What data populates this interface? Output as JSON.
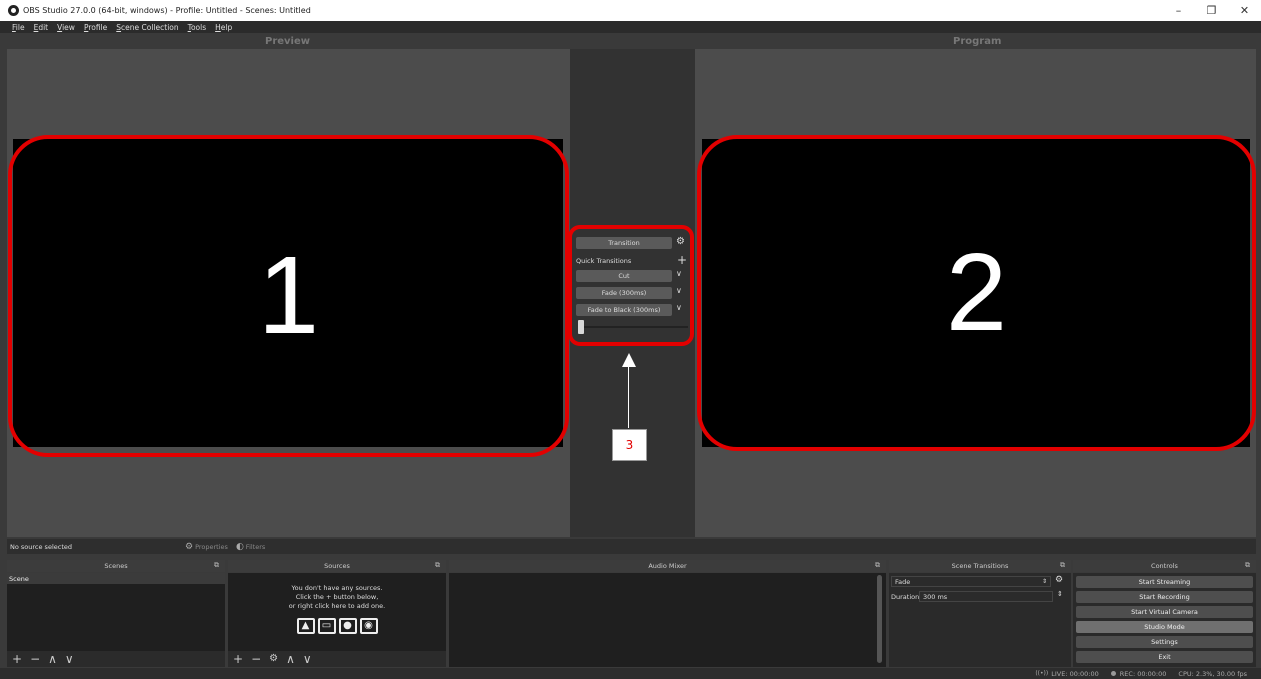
{
  "window": {
    "title": "OBS Studio 27.0.0 (64-bit, windows) - Profile: Untitled - Scenes: Untitled",
    "controls": {
      "minimize": "–",
      "restore": "❐",
      "close": "✕"
    }
  },
  "menu": [
    "File",
    "Edit",
    "View",
    "Profile",
    "Scene Collection",
    "Tools",
    "Help"
  ],
  "preview": {
    "title": "Preview",
    "annotation": "1"
  },
  "program": {
    "title": "Program",
    "annotation": "2"
  },
  "transition_panel": {
    "transition_label": "Transition",
    "quick_transitions_label": "Quick Transitions",
    "quick_items": [
      "Cut",
      "Fade (300ms)",
      "Fade to Black (300ms)"
    ],
    "slider_value": 0,
    "annotation": "3"
  },
  "properties_bar": {
    "no_source": "No source selected",
    "properties_label": "Properties",
    "filters_label": "Filters"
  },
  "docks": {
    "scenes": {
      "title": "Scenes",
      "items": [
        "Scene"
      ]
    },
    "sources": {
      "title": "Sources",
      "empty_lines": [
        "You don't have any sources.",
        "Click the + button below,",
        "or right click here to add one."
      ]
    },
    "audio_mixer": {
      "title": "Audio Mixer"
    },
    "scene_transitions": {
      "title": "Scene Transitions",
      "transition_value": "Fade",
      "duration_label": "Duration",
      "duration_value": "300 ms"
    },
    "controls": {
      "title": "Controls",
      "buttons": [
        "Start Streaming",
        "Start Recording",
        "Start Virtual Camera",
        "Studio Mode",
        "Settings",
        "Exit"
      ],
      "active_button": "Studio Mode"
    }
  },
  "status": {
    "live": "LIVE: 00:00:00",
    "rec": "REC: 00:00:00",
    "cpu": "CPU: 2.3%, 30.00 fps"
  },
  "colors": {
    "annotation": "#e30000",
    "screen": "#000000",
    "panel": "#4c4c4c"
  }
}
